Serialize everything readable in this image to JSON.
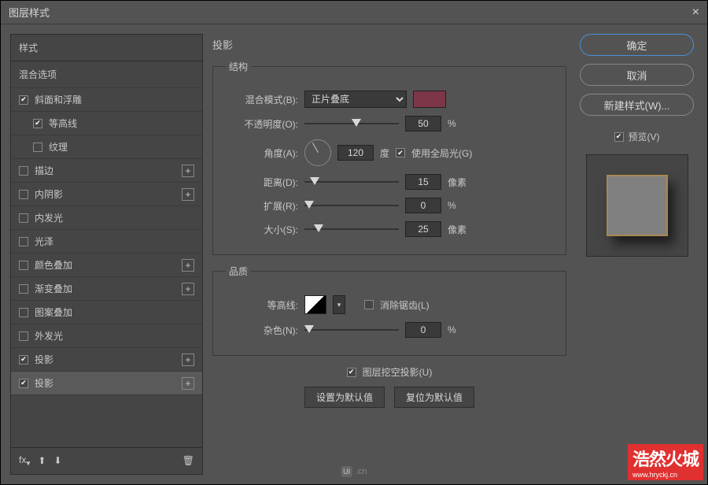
{
  "title": "图层样式",
  "sidebar": {
    "styles_header": "样式",
    "mix_options": "混合选项",
    "items": [
      {
        "label": "斜面和浮雕",
        "checked": true,
        "add": false,
        "indent": false
      },
      {
        "label": "等高线",
        "checked": true,
        "add": false,
        "indent": true
      },
      {
        "label": "纹理",
        "checked": false,
        "add": false,
        "indent": true
      },
      {
        "label": "描边",
        "checked": false,
        "add": true,
        "indent": false
      },
      {
        "label": "内阴影",
        "checked": false,
        "add": true,
        "indent": false
      },
      {
        "label": "内发光",
        "checked": false,
        "add": false,
        "indent": false
      },
      {
        "label": "光泽",
        "checked": false,
        "add": false,
        "indent": false
      },
      {
        "label": "颜色叠加",
        "checked": false,
        "add": true,
        "indent": false
      },
      {
        "label": "渐变叠加",
        "checked": false,
        "add": true,
        "indent": false
      },
      {
        "label": "图案叠加",
        "checked": false,
        "add": false,
        "indent": false
      },
      {
        "label": "外发光",
        "checked": false,
        "add": false,
        "indent": false
      },
      {
        "label": "投影",
        "checked": true,
        "add": true,
        "indent": false
      },
      {
        "label": "投影",
        "checked": true,
        "add": true,
        "indent": false,
        "selected": true
      }
    ],
    "footer_fx": "fx"
  },
  "main": {
    "title": "投影",
    "structure": {
      "legend": "结构",
      "blend_mode_label": "混合模式(B):",
      "blend_mode_value": "正片叠底",
      "swatch_color": "#7d3648",
      "opacity_label": "不透明度(O):",
      "opacity_value": "50",
      "opacity_unit": "%",
      "angle_label": "角度(A):",
      "angle_value": "120",
      "angle_unit": "度",
      "global_light_label": "使用全局光(G)",
      "global_light_checked": true,
      "distance_label": "距离(D):",
      "distance_value": "15",
      "distance_unit": "像素",
      "spread_label": "扩展(R):",
      "spread_value": "0",
      "spread_unit": "%",
      "size_label": "大小(S):",
      "size_value": "25",
      "size_unit": "像素"
    },
    "quality": {
      "legend": "品质",
      "contour_label": "等高线:",
      "antialias_label": "消除锯齿(L)",
      "antialias_checked": false,
      "noise_label": "杂色(N):",
      "noise_value": "0",
      "noise_unit": "%"
    },
    "knockout_label": "图层挖空投影(U)",
    "knockout_checked": true,
    "btn_default": "设置为默认值",
    "btn_reset": "复位为默认值"
  },
  "right": {
    "ok": "确定",
    "cancel": "取消",
    "new_style": "新建样式(W)...",
    "preview_label": "预览(V)",
    "preview_checked": true
  },
  "watermark": {
    "ui": ".cn",
    "logo_main": "浩然火城",
    "logo_url": "www.hryckj.cn"
  }
}
